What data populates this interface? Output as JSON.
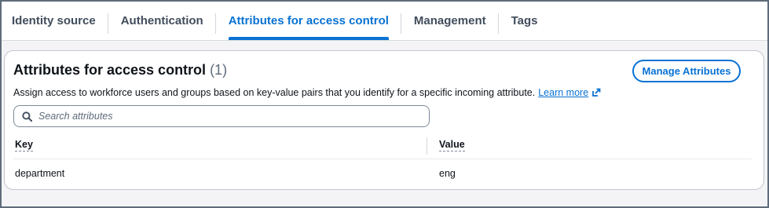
{
  "tabs": [
    {
      "label": "Identity source"
    },
    {
      "label": "Authentication"
    },
    {
      "label": "Attributes for access control",
      "active": true
    },
    {
      "label": "Management"
    },
    {
      "label": "Tags"
    }
  ],
  "section": {
    "title": "Attributes for access control",
    "count": "(1)",
    "manage_button": "Manage Attributes",
    "description": "Assign access to workforce users and groups based on key-value pairs that you identify for a specific incoming attribute.",
    "learn_more": "Learn more",
    "search_placeholder": "Search attributes"
  },
  "table": {
    "columns": [
      "Key",
      "Value"
    ],
    "rows": [
      {
        "key": "department",
        "value": "eng"
      }
    ]
  },
  "colors": {
    "accent": "#0972d3",
    "text": "#0f141a",
    "muted": "#5f6b7a"
  },
  "icons": {
    "search": "search-icon",
    "external": "external-link-icon"
  }
}
